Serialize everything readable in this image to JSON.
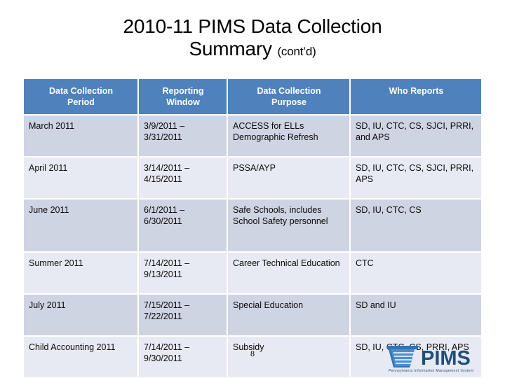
{
  "slide": {
    "title_line1": "2010-11 PIMS Data Collection",
    "title_line2": "Summary",
    "title_suffix": "(cont’d)",
    "page_number": "8"
  },
  "table": {
    "headers": [
      "Data Collection Period",
      "Reporting Window",
      "Data Collection Purpose",
      "Who Reports"
    ],
    "headers_split": [
      {
        "l1": "Data Collection",
        "l2": "Period"
      },
      {
        "l1": "Reporting",
        "l2": "Window"
      },
      {
        "l1": "Data Collection",
        "l2": "Purpose"
      },
      {
        "l1": "Who Reports",
        "l2": ""
      }
    ],
    "rows": [
      {
        "period": "March 2011",
        "window": "3/9/2011 – 3/31/2011",
        "purpose": "ACCESS for ELLs Demographic Refresh",
        "who": "SD, IU, CTC, CS, SJCI, PRRI,  and APS"
      },
      {
        "period": "April 2011",
        "window": "3/14/2011 – 4/15/2011",
        "purpose": "PSSA/AYP",
        "who": "SD, IU, CTC, CS, SJCI, PRRI, APS"
      },
      {
        "period": "June 2011",
        "window": "6/1/2011 – 6/30/2011",
        "purpose": "Safe Schools, includes School Safety personnel",
        "who": "SD, IU, CTC, CS"
      },
      {
        "period": "Summer 2011",
        "window": "7/14/2011 – 9/13/2011",
        "purpose": "Career Technical Education",
        "who": "CTC"
      },
      {
        "period": "July 2011",
        "window": "7/15/2011 – 7/22/2011",
        "purpose": "Special Education",
        "who": "SD and IU"
      },
      {
        "period": "Child Accounting 2011",
        "window": "7/14/2011 – 9/30/2011",
        "purpose": "Subsidy",
        "who": "SD, IU, CTC, CS, PRRI, APS"
      }
    ]
  },
  "logo": {
    "wordmark": "PIMS",
    "tagline": "Pennsylvania Information Management System"
  },
  "colors": {
    "header_blue": "#4F81BD",
    "row_dark": "#CFD4E3",
    "row_light": "#E7EAF2",
    "logo_blue": "#1F4E79",
    "logo_mark": "#2E75B6"
  }
}
